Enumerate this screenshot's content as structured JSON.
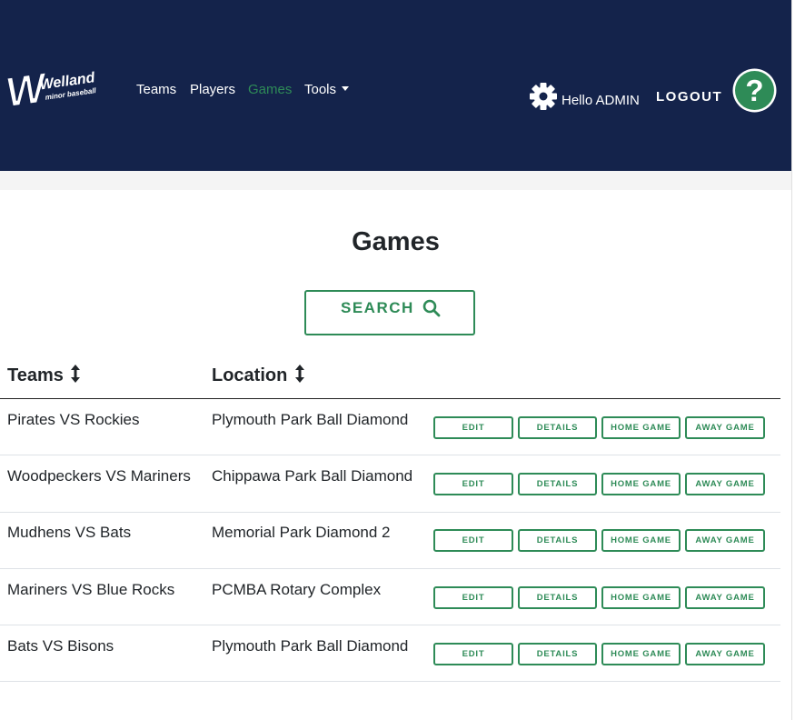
{
  "header": {
    "logo": {
      "word": "Welland",
      "subtitle": "minor baseball"
    },
    "nav": [
      {
        "label": "Teams",
        "active": false
      },
      {
        "label": "Players",
        "active": false
      },
      {
        "label": "Games",
        "active": true
      },
      {
        "label": "Tools",
        "active": false,
        "dropdown": true
      }
    ],
    "greeting": "Hello ADMIN",
    "logout_label": "LOGOUT",
    "help_icon": "question-circle-icon",
    "settings_icon": "gear-icon"
  },
  "colors": {
    "navbar_bg": "#14234b",
    "accent_green": "#2e8b57",
    "active_nav": "#2e8b57",
    "text": "#212529"
  },
  "page": {
    "title": "Games",
    "search_label": "SEARCH",
    "search_icon": "magnifier-icon"
  },
  "table": {
    "columns": [
      {
        "label": "Teams",
        "sortable": true
      },
      {
        "label": "Location",
        "sortable": true
      }
    ],
    "action_labels": {
      "edit": "EDIT",
      "details": "DETAILS",
      "home": "HOME GAME",
      "away": "AWAY GAME"
    },
    "rows": [
      {
        "teams": "Pirates VS Rockies",
        "location": "Plymouth Park Ball Diamond"
      },
      {
        "teams": "Woodpeckers VS Mariners",
        "location": "Chippawa Park Ball Diamond"
      },
      {
        "teams": "Mudhens VS Bats",
        "location": "Memorial Park Diamond 2"
      },
      {
        "teams": "Mariners VS Blue Rocks",
        "location": "PCMBA Rotary Complex"
      },
      {
        "teams": "Bats VS Bisons",
        "location": "Plymouth Park Ball Diamond"
      }
    ]
  }
}
